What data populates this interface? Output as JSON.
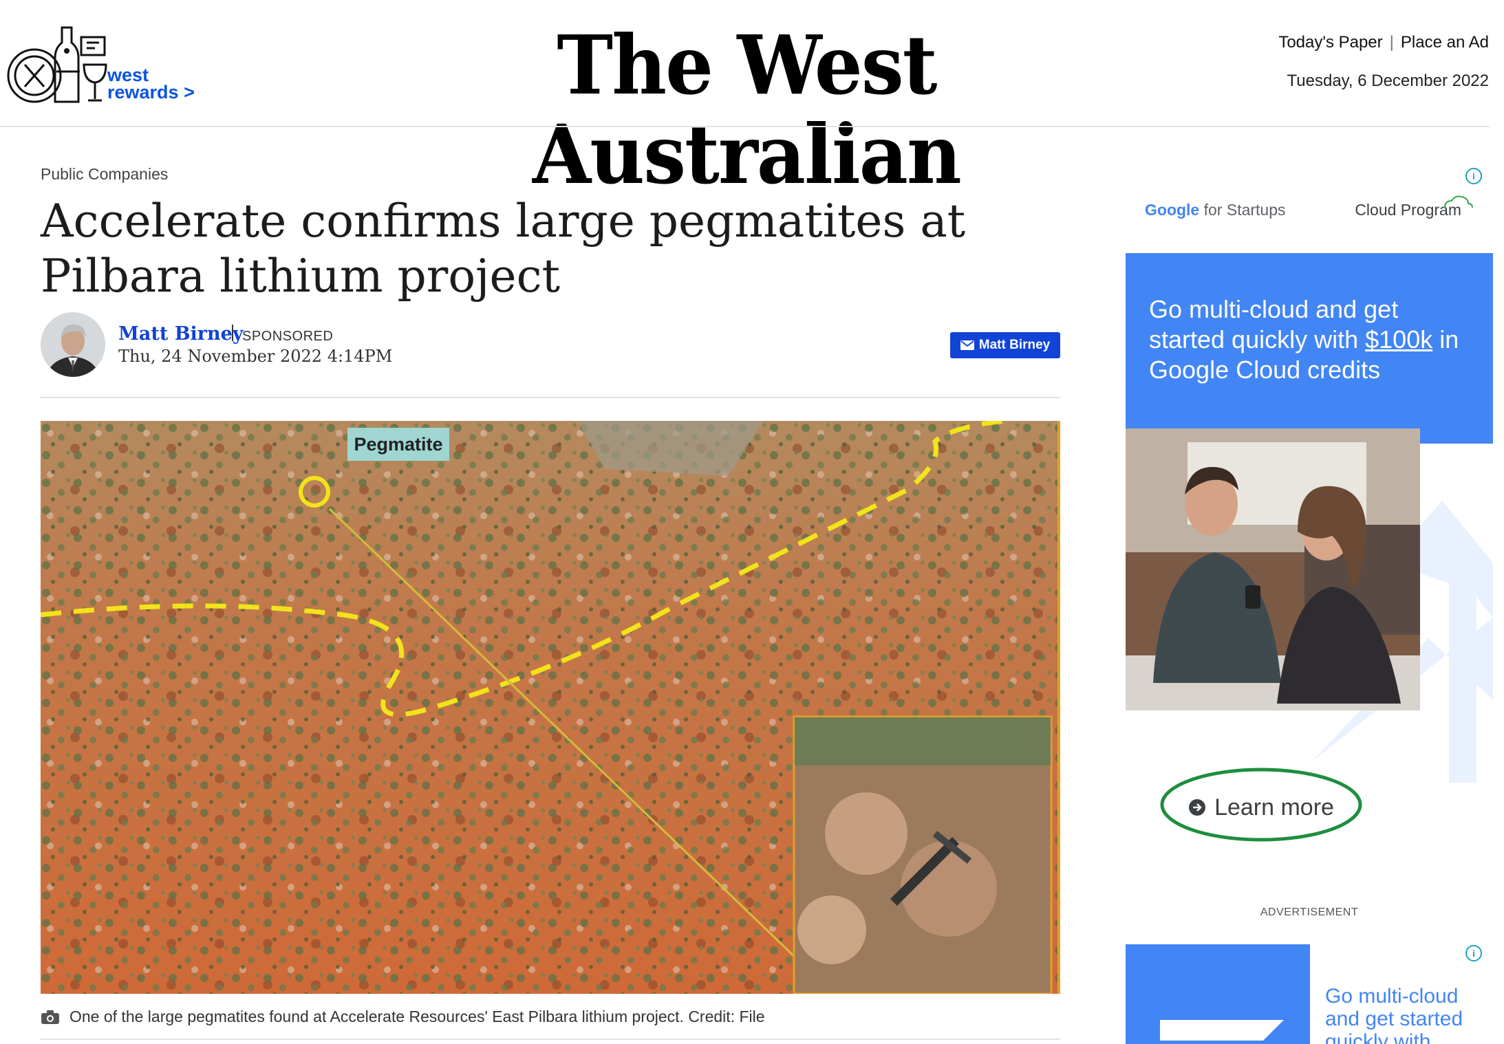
{
  "header": {
    "rewards_line1": "west",
    "rewards_line2": "rewards",
    "rewards_chevron": ">",
    "masthead": "The West Australian",
    "links": [
      "Today's Paper",
      "Place an Ad"
    ],
    "link_separator": "|",
    "date": "Tuesday, 6 December 2022"
  },
  "article": {
    "category": "Public Companies",
    "headline": "Accelerate confirms large pegmatites at Pilbara lithium project",
    "author": "Matt Birney",
    "sponsored": "SPONSORED",
    "published": "Thu, 24 November 2022 4:14PM",
    "email_button": "Matt Birney",
    "photo_label": "Pegmatite",
    "caption": "One of the large pegmatites found at Accelerate Resources' East Pilbara lithium project. Credit: File"
  },
  "ad": {
    "brand_google": "Google",
    "brand_startups": "for Startups",
    "cloud_program": "Cloud Program",
    "headline_pre": "Go multi-cloud and get started quickly with ",
    "headline_amount": "$100k",
    "headline_post": " in Google Cloud credits",
    "cta": "Learn more",
    "label": "ADVERTISEMENT",
    "ad2_text": "Go multi-cloud and get started quickly with"
  },
  "colors": {
    "link_blue": "#1043d6",
    "rewards_blue": "#0b54e0",
    "google_blue": "#4285f4",
    "cta_ring_green": "#1e8e3e",
    "dash_yellow": "#f2e31a"
  }
}
